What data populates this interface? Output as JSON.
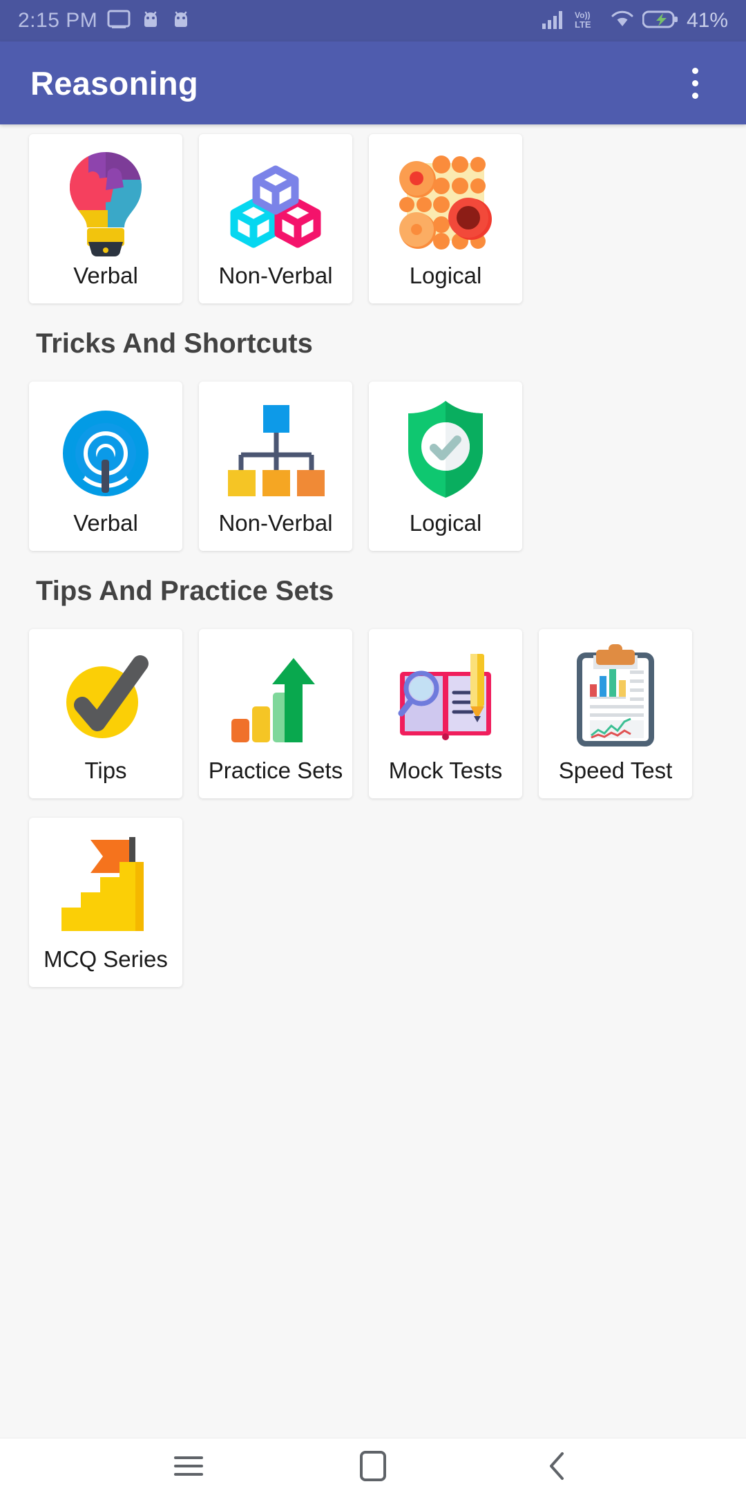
{
  "status_bar": {
    "time": "2:15 PM",
    "battery_percent": "41%",
    "network_label": "VoLTE",
    "icons": [
      "cast-icon",
      "android-bug-icon",
      "android-bug-icon",
      "signal-bars-icon",
      "volte-icon",
      "wifi-icon",
      "battery-charging-icon"
    ]
  },
  "app_bar": {
    "title": "Reasoning",
    "overflow_menu": "overflow-menu-icon"
  },
  "sections": [
    {
      "id": "main-categories",
      "title": "",
      "cards": [
        {
          "label": "Verbal",
          "icon": "puzzle-lightbulb-icon"
        },
        {
          "label": "Non-Verbal",
          "icon": "isometric-cubes-icon"
        },
        {
          "label": "Logical",
          "icon": "orange-dots-grid-icon"
        }
      ]
    },
    {
      "id": "tricks-and-shortcuts",
      "title": "Tricks And Shortcuts",
      "cards": [
        {
          "label": "Verbal",
          "icon": "broadcast-signal-icon"
        },
        {
          "label": "Non-Verbal",
          "icon": "hierarchy-chart-icon"
        },
        {
          "label": "Logical",
          "icon": "green-shield-check-icon"
        }
      ]
    },
    {
      "id": "tips-and-practice-sets",
      "title": "Tips And Practice Sets",
      "cards": [
        {
          "label": "Tips",
          "icon": "yellow-checkmark-icon"
        },
        {
          "label": "Practice Sets",
          "icon": "green-growth-arrow-icon"
        },
        {
          "label": "Mock Tests",
          "icon": "book-magnifier-pencil-icon"
        },
        {
          "label": "Speed Test",
          "icon": "clipboard-chart-icon"
        },
        {
          "label": "MCQ Series",
          "icon": "stairs-flag-icon"
        }
      ]
    }
  ],
  "nav_bar": {
    "recents": "menu-icon",
    "home": "home-square-icon",
    "back": "back-chevron-icon"
  },
  "colors": {
    "app_bar": "#4f5cae",
    "status_bar": "#4a559e",
    "background": "#f7f7f7",
    "card": "#ffffff",
    "section_title": "#424242",
    "label": "#1a1a1a"
  }
}
